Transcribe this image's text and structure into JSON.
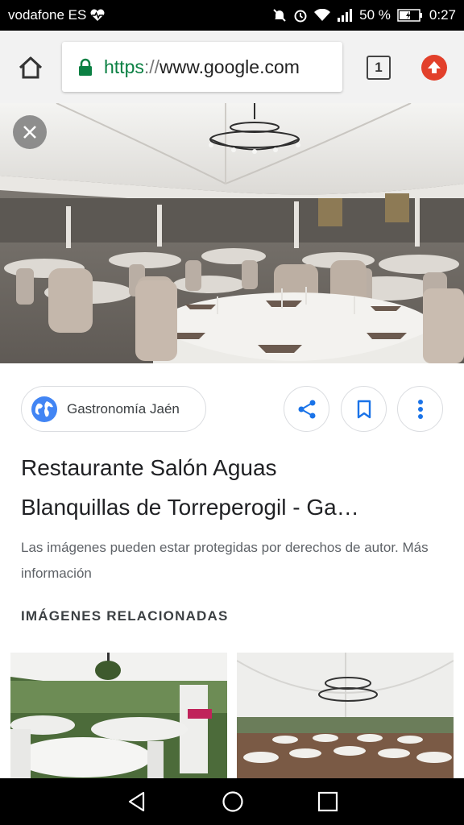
{
  "status_bar": {
    "carrier": "vodafone ES",
    "battery": "50 %",
    "time": "0:27"
  },
  "toolbar": {
    "url_scheme": "https",
    "url_separator": "://",
    "url_host": "www.google.com",
    "tab_count": "1"
  },
  "result": {
    "source": "Gastronomía Jaén",
    "title_line1": "Restaurante Salón Aguas",
    "title_line2": "Blanquillas de Torreperogil - Ga…",
    "notice": "Las imágenes pueden estar protegidas por derechos de autor. Más información"
  },
  "related": {
    "heading": "IMÁGENES RELACIONADAS"
  },
  "colors": {
    "url_green": "#0b8043",
    "update_red": "#e2402b",
    "icon_blue": "#1a73e8"
  }
}
